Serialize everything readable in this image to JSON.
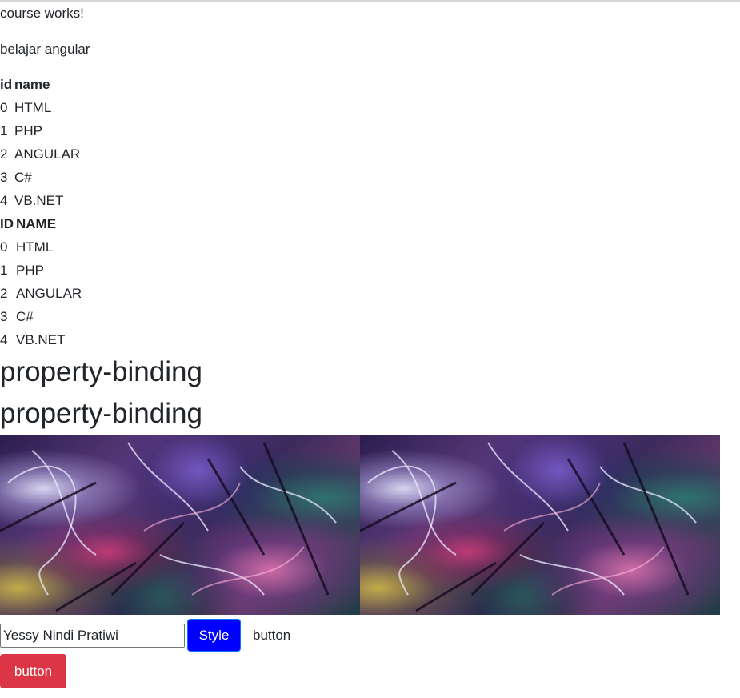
{
  "course_works": "course works!",
  "subtitle": "belajar angular",
  "table_lower": {
    "headers": {
      "id": "id",
      "name": "name"
    },
    "rows": [
      {
        "id": "0",
        "name": "HTML"
      },
      {
        "id": "1",
        "name": "PHP"
      },
      {
        "id": "2",
        "name": "ANGULAR"
      },
      {
        "id": "3",
        "name": "C#"
      },
      {
        "id": "4",
        "name": "VB.NET"
      }
    ]
  },
  "table_upper": {
    "headers": {
      "id": "ID",
      "name": "NAME"
    },
    "rows": [
      {
        "id": "0",
        "name": "HTML"
      },
      {
        "id": "1",
        "name": "PHP"
      },
      {
        "id": "2",
        "name": "ANGULAR"
      },
      {
        "id": "3",
        "name": "C#"
      },
      {
        "id": "4",
        "name": "VB.NET"
      }
    ]
  },
  "headings": [
    "property-binding",
    "property-binding"
  ],
  "images": [
    {
      "name": "abstract-image-1"
    },
    {
      "name": "abstract-image-2"
    }
  ],
  "form": {
    "name_value": "Yessy Nindi Pratiwi",
    "style_button": "Style",
    "plain_button": "button",
    "danger_button": "button"
  },
  "colors": {
    "style_button_bg": "#0000ff",
    "danger_button_bg": "#dc3545",
    "text": "#212529"
  }
}
